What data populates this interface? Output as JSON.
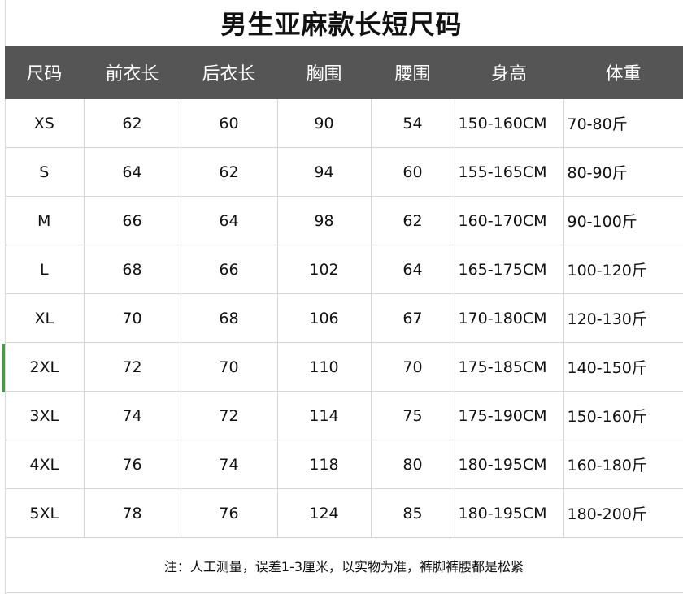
{
  "title": "男生亚麻款长短尺码",
  "headers": [
    "尺码",
    "前衣长",
    "后衣长",
    "胸围",
    "腰围",
    "身高",
    "体重"
  ],
  "rows": [
    [
      "XS",
      "62",
      "60",
      "90",
      "54",
      "150-160CM",
      "70-80斤"
    ],
    [
      "S",
      "64",
      "62",
      "94",
      "60",
      "155-165CM",
      "80-90斤"
    ],
    [
      "M",
      "66",
      "64",
      "98",
      "62",
      "160-170CM",
      "90-100斤"
    ],
    [
      "L",
      "68",
      "66",
      "102",
      "64",
      "165-175CM",
      "100-120斤"
    ],
    [
      "XL",
      "70",
      "68",
      "106",
      "67",
      "170-180CM",
      "120-130斤"
    ],
    [
      "2XL",
      "72",
      "70",
      "110",
      "70",
      "175-185CM",
      "140-150斤"
    ],
    [
      "3XL",
      "74",
      "72",
      "114",
      "75",
      "175-190CM",
      "150-160斤"
    ],
    [
      "4XL",
      "76",
      "74",
      "118",
      "80",
      "180-195CM",
      "160-180斤"
    ],
    [
      "5XL",
      "78",
      "76",
      "124",
      "85",
      "180-195CM",
      "180-200斤"
    ]
  ],
  "note": "注：人工测量，误差1-3厘米，以实物为准，裤脚裤腰都是松紧",
  "colors": {
    "header_bg": "#555555",
    "header_text": "#ffffff",
    "grid": "#d4d4d4",
    "selection": "#3ea33e"
  }
}
